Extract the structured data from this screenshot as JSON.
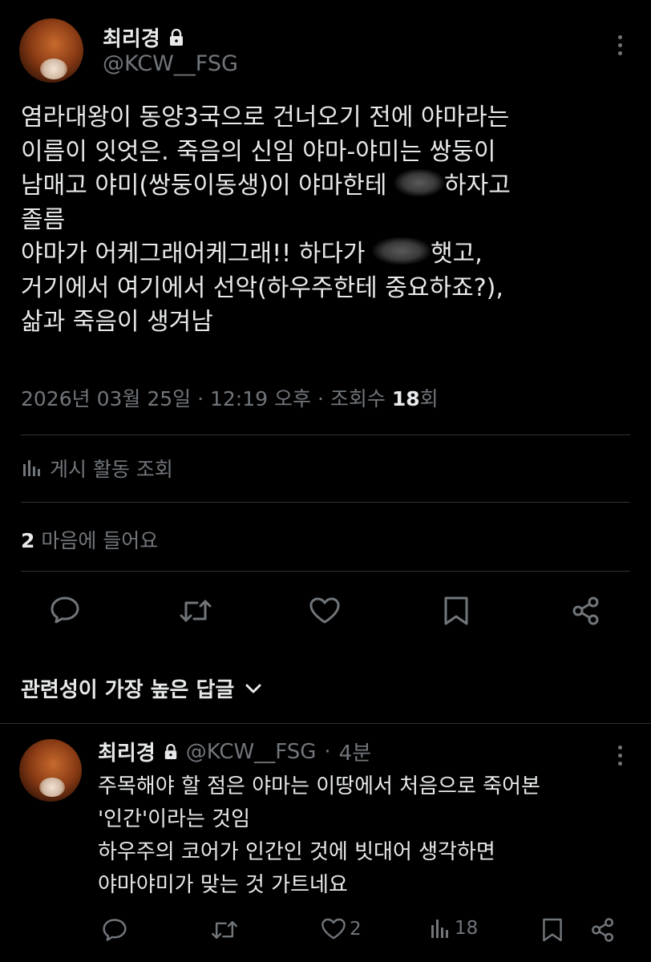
{
  "post": {
    "author_name": "최리경",
    "author_handle": "@KCW__FSG",
    "body_lines": [
      "염라대왕이 동양3국으로 건너오기 전에 야마라는",
      "이름이 잇엇은. 죽음의 신임 야마-야미는 쌍둥이",
      "남매고 야미(쌍둥이동생)이 야마한테",
      "하자고",
      "졸름",
      "야마가 어케그래어케그래!! 하다가",
      "햇고,",
      "거기에서 여기에서 선악(하우주한테 중요하죠?),",
      "삶과 죽음이 생겨남"
    ],
    "date": "2026년 03월 25일",
    "time": "12:19 오후",
    "views_label": "조회수",
    "views_count": "18",
    "views_suffix": "회",
    "activity_label": "게시 활동 조회",
    "likes_count": "2",
    "likes_label": "마음에 들어요"
  },
  "replies_header": {
    "label": "관련성이 가장 높은 답글"
  },
  "reply": {
    "author_name": "최리경",
    "author_handle": "@KCW__FSG",
    "time_ago": "4분",
    "body_lines": [
      "주목해야 할 점은 야마는 이땅에서 처음으로 죽어본",
      "'인간'이라는 것임",
      "하우주의 코어가 인간인 것에 빗대어 생각하면",
      "야마야미가 맞는 것 가트네요"
    ],
    "likes": "2",
    "views": "18"
  },
  "icons": {
    "lock": "lock-icon",
    "more": "more-icon",
    "reply": "reply-icon",
    "retweet": "retweet-icon",
    "like": "heart-icon",
    "bookmark": "bookmark-icon",
    "share": "share-icon",
    "analytics": "analytics-icon",
    "chevron": "chevron-down-icon"
  },
  "colors": {
    "background": "#000000",
    "text": "#e7e9ea",
    "secondary": "#71767b",
    "divider": "#2f3336"
  }
}
